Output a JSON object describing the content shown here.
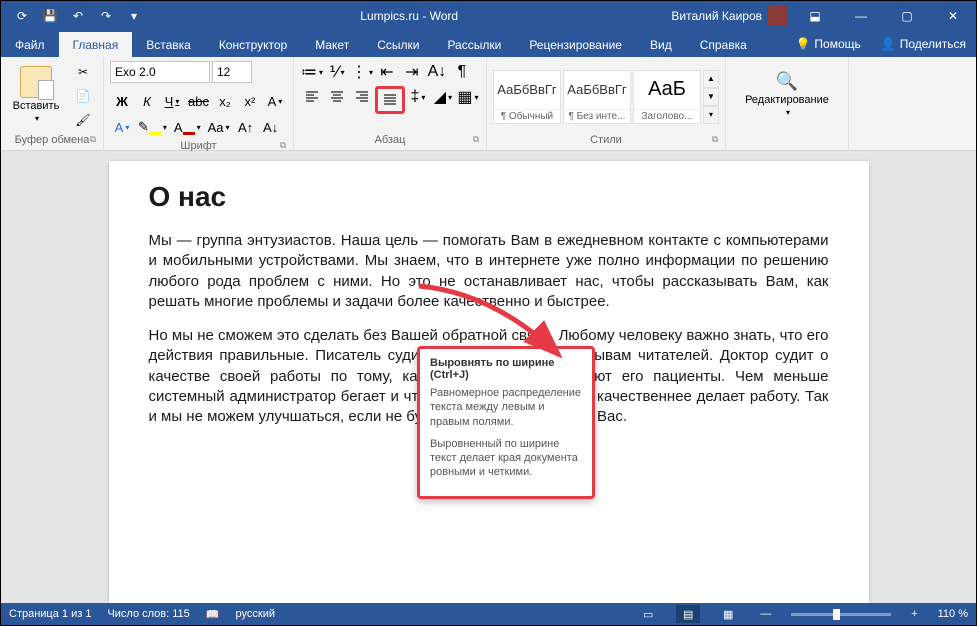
{
  "titlebar": {
    "title": "Lumpics.ru  -  Word",
    "user": "Виталий Каиров"
  },
  "tabs": {
    "file": "Файл",
    "home": "Главная",
    "insert": "Вставка",
    "design": "Конструктор",
    "layout": "Макет",
    "references": "Ссылки",
    "mailings": "Рассылки",
    "review": "Рецензирование",
    "view": "Вид",
    "help": "Справка",
    "tellme": "Помощь",
    "share": "Поделиться"
  },
  "ribbon": {
    "clipboard": {
      "paste": "Вставить",
      "label": "Буфер обмена"
    },
    "font": {
      "name": "Exo 2.0",
      "size": "12",
      "label": "Шрифт"
    },
    "paragraph": {
      "label": "Абзац"
    },
    "styles": {
      "label": "Стили",
      "items": [
        {
          "preview": "АаБбВвГг",
          "name": "¶ Обычный"
        },
        {
          "preview": "АаБбВвГг",
          "name": "¶ Без инте..."
        },
        {
          "preview": "АаБ",
          "name": "Заголово..."
        }
      ]
    },
    "editing": {
      "label": "Редактирование"
    }
  },
  "tooltip": {
    "title": "Выровнять по ширине (Ctrl+J)",
    "p1": "Равномерное распределение текста между левым и правым полями.",
    "p2": "Выровненный по ширине текст делает края документа ровными и четкими."
  },
  "document": {
    "heading": "О нас",
    "para1": "Мы — группа энтузиастов. Наша цель — помогать Вам в ежедневном контакте с компьютерами и мобильными устройствами. Мы знаем, что в интернете уже полно информации по решению любого рода проблем с ними. Но это не останавливает нас, чтобы рассказывать Вам, как решать многие проблемы и задачи более качественно и быстрее.",
    "para2": "Но мы не сможем это сделать без Вашей обратной связи. Любому человеку важно знать, что его действия правильные. Писатель судит о своей работе по отзывам читателей. Доктор судит о качестве своей работы по тому, как быстро выздоравливают его пациенты. Чем меньше системный администратор бегает и что-то настраивает, тем он качественнее делает работу. Так и мы не можем улучшаться, если не будем получать ответов от Вас."
  },
  "statusbar": {
    "page": "Страница 1 из 1",
    "words": "Число слов: 115",
    "lang": "русский",
    "zoom": "110 %"
  }
}
